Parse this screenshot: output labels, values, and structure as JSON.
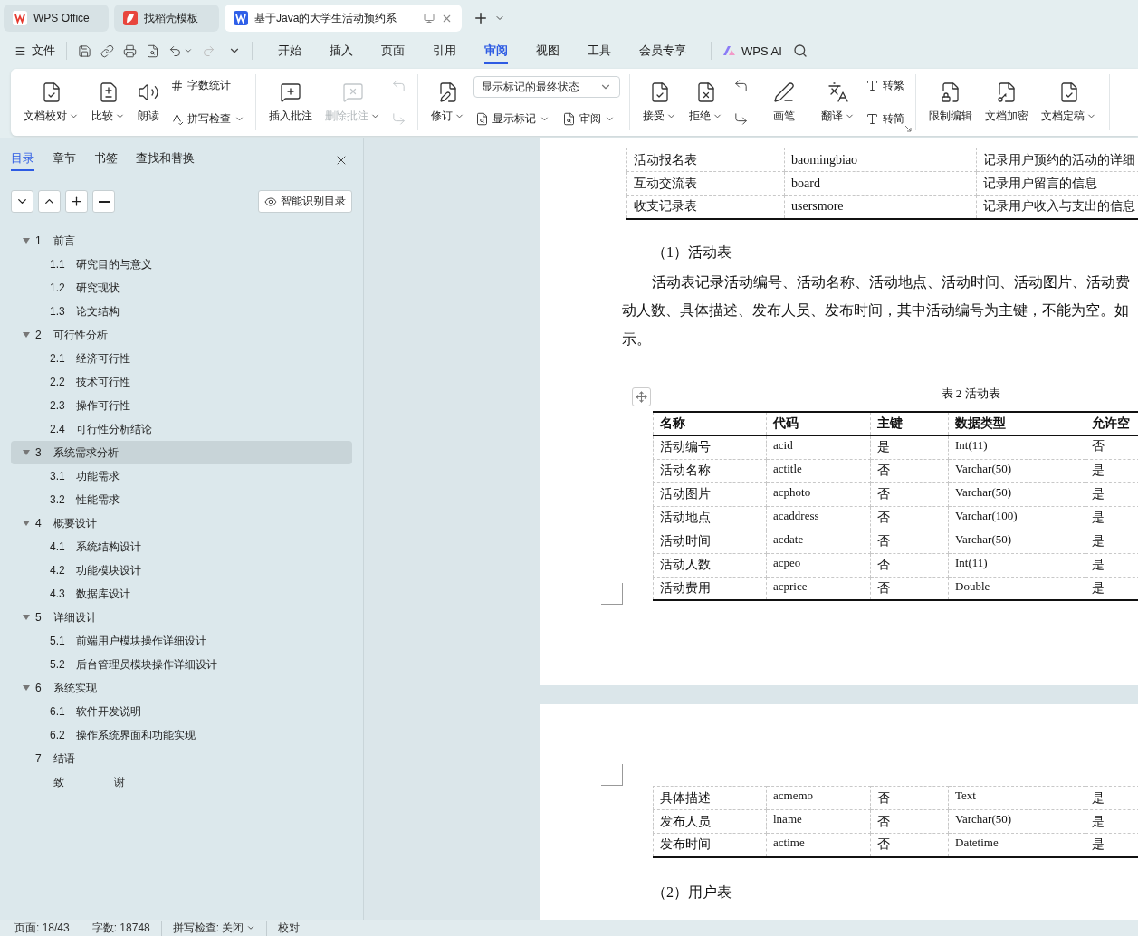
{
  "browser_tabs": [
    {
      "label": "WPS Office",
      "kind": "wps",
      "selected": false
    },
    {
      "label": "找稻壳模板",
      "kind": "docer",
      "selected": false
    },
    {
      "label": "基于Java的大学生活动预约系",
      "kind": "writer",
      "selected": true
    }
  ],
  "menu": {
    "file": "文件",
    "tabs": [
      {
        "label": "开始",
        "selected": false
      },
      {
        "label": "插入",
        "selected": false
      },
      {
        "label": "页面",
        "selected": false
      },
      {
        "label": "引用",
        "selected": false
      },
      {
        "label": "审阅",
        "selected": true
      },
      {
        "label": "视图",
        "selected": false
      },
      {
        "label": "工具",
        "selected": false
      },
      {
        "label": "会员专享",
        "selected": false
      }
    ],
    "ai": "WPS AI"
  },
  "ribbon": [
    {
      "columns": [
        [
          {
            "kind": "large",
            "label": "文档校对",
            "dropdown": true,
            "disabled": false
          }
        ],
        [
          {
            "kind": "large",
            "label": "比较",
            "dropdown": true,
            "disabled": false
          }
        ],
        [
          {
            "kind": "large",
            "label": "朗读",
            "dropdown": false,
            "disabled": false
          }
        ],
        [
          {
            "kind": "small",
            "label": "字数统计",
            "dropdown": false,
            "disabled": false
          },
          {
            "kind": "small",
            "label": "拼写检查",
            "dropdown": true,
            "disabled": false
          }
        ]
      ]
    },
    {
      "columns": [
        [
          {
            "kind": "large",
            "label": "插入批注",
            "dropdown": false,
            "disabled": false
          }
        ],
        [
          {
            "kind": "large",
            "label": "删除批注",
            "dropdown": true,
            "disabled": true
          }
        ],
        [
          {
            "kind": "icon",
            "disabled": true
          },
          {
            "kind": "icon",
            "disabled": true
          }
        ]
      ]
    },
    {
      "columns": [
        [
          {
            "kind": "large",
            "label": "修订",
            "dropdown": true,
            "disabled": false
          }
        ],
        [
          {
            "kind": "select",
            "value": "显示标记的最终状态"
          },
          {
            "kind": "row",
            "items": [
              {
                "kind": "small",
                "label": "显示标记",
                "dropdown": true,
                "disabled": false
              },
              {
                "kind": "small",
                "label": "审阅",
                "dropdown": true,
                "disabled": false
              }
            ]
          }
        ]
      ]
    },
    {
      "columns": [
        [
          {
            "kind": "large",
            "label": "接受",
            "dropdown": true,
            "disabled": false
          }
        ],
        [
          {
            "kind": "large",
            "label": "拒绝",
            "dropdown": true,
            "disabled": false
          }
        ],
        [
          {
            "kind": "icon",
            "disabled": false
          },
          {
            "kind": "icon",
            "disabled": false
          }
        ]
      ]
    },
    {
      "columns": [
        [
          {
            "kind": "large",
            "label": "画笔",
            "dropdown": false,
            "disabled": false
          }
        ]
      ]
    },
    {
      "columns": [
        [
          {
            "kind": "large",
            "label": "翻译",
            "dropdown": true,
            "disabled": false
          }
        ],
        [
          {
            "kind": "small",
            "label": "转繁",
            "dropdown": false,
            "disabled": false
          },
          {
            "kind": "small",
            "label": "转简",
            "dropdown": false,
            "disabled": false
          }
        ]
      ],
      "launcher": true
    },
    {
      "columns": [
        [
          {
            "kind": "large",
            "label": "限制编辑",
            "dropdown": false,
            "disabled": false
          }
        ],
        [
          {
            "kind": "large",
            "label": "文档加密",
            "dropdown": false,
            "disabled": false
          }
        ],
        [
          {
            "kind": "large",
            "label": "文档定稿",
            "dropdown": true,
            "disabled": false
          }
        ]
      ]
    }
  ],
  "nav_panel": {
    "tabs": [
      {
        "label": "目录",
        "selected": true
      },
      {
        "label": "章节",
        "selected": false
      },
      {
        "label": "书签",
        "selected": false
      },
      {
        "label": "查找和替换",
        "selected": false
      }
    ],
    "smart_button": "智能识别目录",
    "toc": [
      {
        "number": "1",
        "title": "前言",
        "expanded": true,
        "selected": false,
        "children": [
          {
            "number": "1.1",
            "title": "研究目的与意义",
            "selected": false
          },
          {
            "number": "1.2",
            "title": "研究现状",
            "selected": false
          },
          {
            "number": "1.3",
            "title": "论文结构",
            "selected": false
          }
        ]
      },
      {
        "number": "2",
        "title": "可行性分析",
        "expanded": true,
        "selected": false,
        "children": [
          {
            "number": "2.1",
            "title": "经济可行性",
            "selected": false
          },
          {
            "number": "2.2",
            "title": "技术可行性",
            "selected": false
          },
          {
            "number": "2.3",
            "title": "操作可行性",
            "selected": false
          },
          {
            "number": "2.4",
            "title": "可行性分析结论",
            "selected": false
          }
        ]
      },
      {
        "number": "3",
        "title": "系统需求分析",
        "expanded": true,
        "selected": true,
        "children": [
          {
            "number": "3.1",
            "title": "功能需求",
            "selected": false
          },
          {
            "number": "3.2",
            "title": "性能需求",
            "selected": false
          }
        ]
      },
      {
        "number": "4",
        "title": "概要设计",
        "expanded": true,
        "selected": false,
        "children": [
          {
            "number": "4.1",
            "title": "系统结构设计",
            "selected": false
          },
          {
            "number": "4.2",
            "title": "功能模块设计",
            "selected": false
          },
          {
            "number": "4.3",
            "title": "数据库设计",
            "selected": false
          }
        ]
      },
      {
        "number": "5",
        "title": "详细设计",
        "expanded": true,
        "selected": false,
        "children": [
          {
            "number": "5.1",
            "title": "前端用户模块操作详细设计",
            "selected": false
          },
          {
            "number": "5.2",
            "title": "后台管理员模块操作详细设计",
            "selected": false
          }
        ]
      },
      {
        "number": "6",
        "title": "系统实现",
        "expanded": true,
        "selected": false,
        "children": [
          {
            "number": "6.1",
            "title": "软件开发说明",
            "selected": false
          },
          {
            "number": "6.2",
            "title": "操作系统界面和功能实现",
            "selected": false
          }
        ]
      },
      {
        "number": "7",
        "title": "结语",
        "selected": false
      },
      {
        "title": "致 谢",
        "selected": false
      }
    ]
  },
  "document": {
    "table_1": {
      "rows": [
        [
          "活动报名表",
          "baomingbiao",
          "记录用户预约的活动的详细"
        ],
        [
          "互动交流表",
          "board",
          "记录用户留言的信息"
        ],
        [
          "收支记录表",
          "usersmore",
          "记录用户收入与支出的信息"
        ]
      ]
    },
    "heading_1": "（1）活动表",
    "paragraph_lines": [
      "活动表记录活动编号、活动名称、活动地点、活动时间、活动图片、活动费",
      "动人数、具体描述、发布人员、发布时间，其中活动编号为主键，不能为空。如",
      "示。"
    ],
    "caption": "表 2  活动表",
    "table_2": {
      "columns": [
        "名称",
        "代码",
        "主键",
        "数据类型",
        "允许空"
      ],
      "rows": [
        [
          "活动编号",
          "acid",
          "是",
          "Int(11)",
          "否"
        ],
        [
          "活动名称",
          "actitle",
          "否",
          "Varchar(50)",
          "是"
        ],
        [
          "活动图片",
          "acphoto",
          "否",
          "Varchar(50)",
          "是"
        ],
        [
          "活动地点",
          "acaddress",
          "否",
          "Varchar(100)",
          "是"
        ],
        [
          "活动时间",
          "acdate",
          "否",
          "Varchar(50)",
          "是"
        ],
        [
          "活动人数",
          "acpeo",
          "否",
          "Int(11)",
          "是"
        ],
        [
          "活动费用",
          "acprice",
          "否",
          "Double",
          "是"
        ]
      ]
    },
    "table_2_continued": {
      "rows": [
        [
          "具体描述",
          "acmemo",
          "否",
          "Text",
          "是"
        ],
        [
          "发布人员",
          "lname",
          "否",
          "Varchar(50)",
          "是"
        ],
        [
          "发布时间",
          "actime",
          "否",
          "Datetime",
          "是"
        ]
      ]
    },
    "heading_2": "（2）用户表"
  },
  "status_bar": {
    "page": "页面: 18/43",
    "words": "字数: 18748",
    "spell": "拼写检查: 关闭",
    "proofread": "校对"
  }
}
